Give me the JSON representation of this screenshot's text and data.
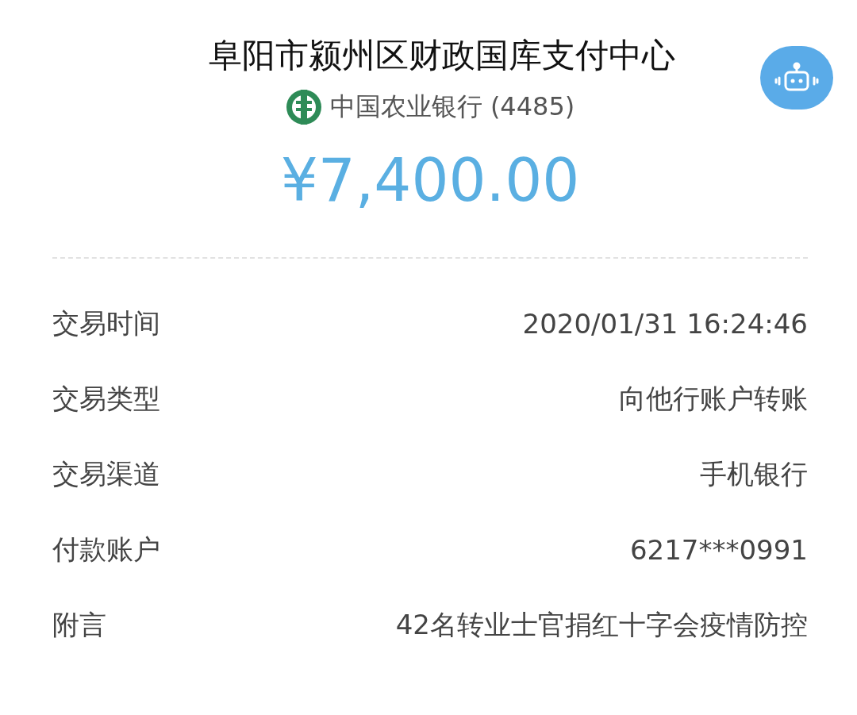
{
  "header": {
    "payee": "阜阳市颍州区财政国库支付中心",
    "bank": "中国农业银行 (4485)",
    "amount": "¥7,400.00"
  },
  "details": [
    {
      "label": "交易时间",
      "value": "2020/01/31 16:24:46"
    },
    {
      "label": "交易类型",
      "value": "向他行账户转账"
    },
    {
      "label": "交易渠道",
      "value": "手机银行"
    },
    {
      "label": "付款账户",
      "value": "6217***0991"
    },
    {
      "label": "附言",
      "value": "42名转业士官捐红十字会疫情防控"
    }
  ]
}
